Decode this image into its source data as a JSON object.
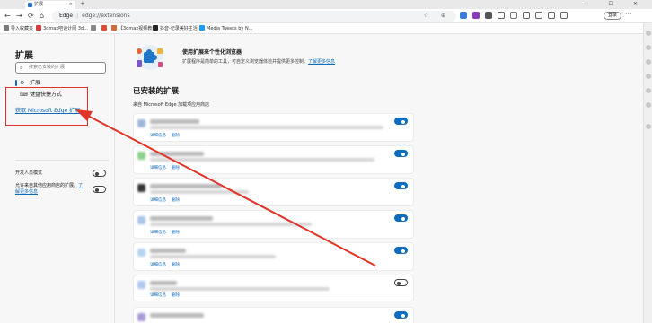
{
  "browser": {
    "tab_title": "扩展",
    "tab_close": "×",
    "new_tab": "+",
    "window_controls": "— ☐ ✕",
    "nav_back": "←",
    "nav_forward": "→",
    "nav_refresh": "⟳",
    "nav_home": "⌂",
    "address_label": "Edge",
    "address_sep": "|",
    "address_url": "edge://extensions",
    "omnibox_icons": "☆ ⊕",
    "login_label": "登录",
    "menu_label": "···",
    "favorites": [
      {
        "label": "导入收藏夹",
        "color": "#7a7a7a"
      },
      {
        "label": "3dmax吧设计网 3d...",
        "color": "#d04040"
      },
      {
        "label": "",
        "color": "#888888"
      },
      {
        "label": "",
        "color": "#e04d2f"
      },
      {
        "label": "【3dmax视频教程】...",
        "color": "#d36a3a"
      },
      {
        "label": "抖音-记录美好生活",
        "color": "#222222"
      },
      {
        "label": "Media Tweets by N...",
        "color": "#1d9bf0"
      }
    ],
    "extension_icon_colors": [
      "#3b7dd8",
      "#8a3ab9",
      "#555555",
      "#666666",
      "#777777",
      "#666666",
      "#666666",
      "#666666",
      "#666666"
    ]
  },
  "sidebar": {
    "title": "扩展",
    "search_placeholder": "搜索已安装的扩展",
    "search_icon": "⌕",
    "items": [
      {
        "label": "扩展",
        "icon": "⚙",
        "active": true
      },
      {
        "label": "键盘快捷方式",
        "icon": "⌨",
        "active": false
      }
    ],
    "get_extensions_link": "获取 Microsoft Edge 扩展",
    "dev_mode_label": "开发人员模式",
    "dev_mode_on": false,
    "other_stores_text": "允许来自其他应用商店的扩展。",
    "other_stores_link_a": "了",
    "other_stores_link_b": "解更多信息",
    "other_stores_on": false
  },
  "main": {
    "promo_title": "使用扩展来个性化浏览器",
    "promo_desc": "扩展程序是简单的工具，可自定义浏览器体验并提供更多控制。",
    "promo_link": "了解更多信息",
    "installed_title": "已安装的扩展",
    "source_label": "来自 Microsoft Edge 加载项应用商店",
    "details_label": "详细信息",
    "remove_label": "删除",
    "cards": [
      {
        "enabled": true,
        "icon_color": "#9db7d9",
        "name_len": 55,
        "desc_len": 260
      },
      {
        "enabled": true,
        "icon_color": "#8fcf8f",
        "name_len": 60,
        "desc_len": 250
      },
      {
        "enabled": true,
        "icon_color": "#333333",
        "name_len": 80,
        "desc_len": 110
      },
      {
        "enabled": true,
        "icon_color": "#a8c4e8",
        "name_len": 70,
        "desc_len": 180
      },
      {
        "enabled": true,
        "icon_color": "#b5d3f0",
        "name_len": 40,
        "desc_len": 140
      },
      {
        "enabled": false,
        "icon_color": "#b0c8ef",
        "name_len": 30,
        "desc_len": 200
      },
      {
        "enabled": true,
        "icon_color": "#a99bd6",
        "name_len": 60,
        "desc_len": 0
      }
    ]
  },
  "colors": {
    "accent": "#0f6cbd",
    "annotation_red": "#e0342b"
  }
}
